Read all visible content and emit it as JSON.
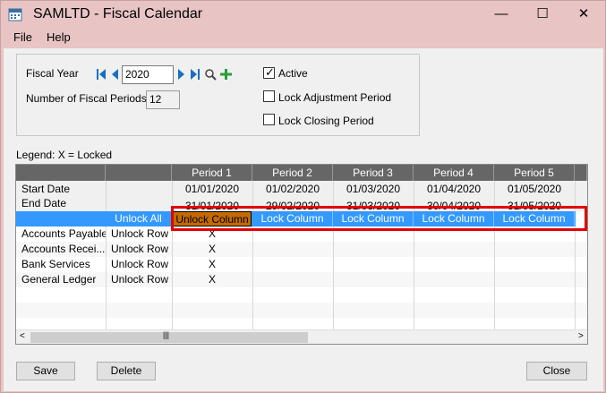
{
  "window": {
    "title": "SAMLTD - Fiscal Calendar",
    "minimize": "—",
    "maximize": "☐",
    "close": "✕"
  },
  "menu": {
    "file": "File",
    "help": "Help"
  },
  "form": {
    "fiscal_year_label": "Fiscal Year",
    "fiscal_year_value": "2020",
    "num_periods_label": "Number of Fiscal Periods",
    "num_periods_value": "12",
    "active_label": "Active",
    "active_checked": true,
    "lock_adjustment_label": "Lock Adjustment Period",
    "lock_closing_label": "Lock Closing Period"
  },
  "legend": "Legend: X = Locked",
  "grid": {
    "columns": [
      "Period 1",
      "Period 2",
      "Period 3",
      "Period 4",
      "Period 5"
    ],
    "start_label": "Start Date",
    "end_label": "End Date",
    "start_dates": [
      "01/01/2020",
      "01/02/2020",
      "01/03/2020",
      "01/04/2020",
      "01/05/2020"
    ],
    "end_dates": [
      "31/01/2020",
      "29/02/2020",
      "31/03/2020",
      "30/04/2020",
      "31/05/2020"
    ],
    "unlock_all": "Unlock All",
    "column_buttons": [
      "Unlock Column",
      "Lock Column",
      "Lock Column",
      "Lock Column",
      "Lock Column"
    ],
    "rows": [
      {
        "name": "Accounts Payable",
        "action": "Unlock Row",
        "p1": "X"
      },
      {
        "name": "Accounts Recei...",
        "action": "Unlock Row",
        "p1": "X"
      },
      {
        "name": "Bank Services",
        "action": "Unlock Row",
        "p1": "X"
      },
      {
        "name": "General Ledger",
        "action": "Unlock Row",
        "p1": "X"
      }
    ],
    "scroll_grip": "|||",
    "scroll_left": "<",
    "scroll_right": ">"
  },
  "buttons": {
    "save": "Save",
    "delete": "Delete",
    "close": "Close"
  },
  "colors": {
    "highlight_row": "#3399ff",
    "unlock_column": "#c46a00",
    "annotation_box": "#e30000"
  }
}
